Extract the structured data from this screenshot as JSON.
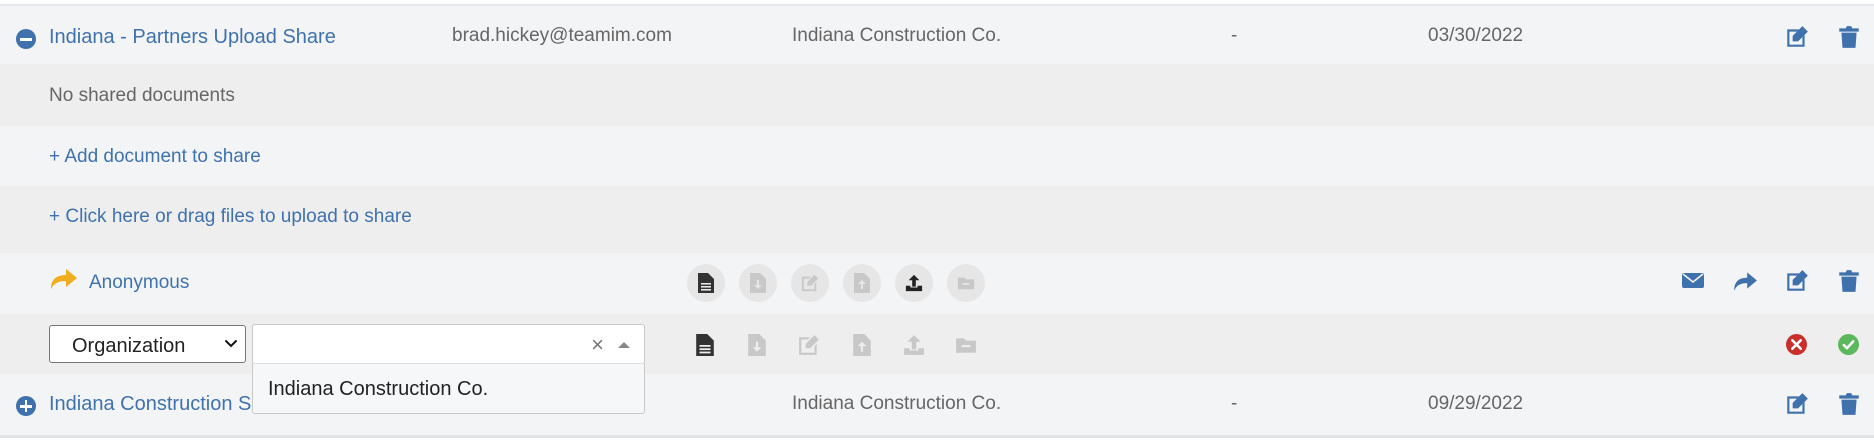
{
  "share1": {
    "name": "Indiana - Partners Upload Share",
    "email": "brad.hickey@teamim.com",
    "organization": "Indiana Construction Co.",
    "dash": "-",
    "date": "03/30/2022",
    "no_docs": "No shared documents",
    "add_doc": "+ Add document to share",
    "upload": "+ Click here or drag files to upload to share",
    "recipient": "Anonymous"
  },
  "new_recipient": {
    "type_select": "Organization",
    "search_value": "",
    "clear_symbol": "×",
    "dropdown_option": "Indiana Construction Co."
  },
  "share2": {
    "name": "Indiana Construction Sh",
    "organization": "Indiana Construction Co.",
    "dash": "-",
    "date": "09/29/2022"
  },
  "colors": {
    "link": "#3f72ad",
    "icon_blue": "#3f72ad",
    "share_arrow": "#f0ad1e",
    "cancel_red": "#c9302c",
    "confirm_green": "#5cb85c"
  }
}
